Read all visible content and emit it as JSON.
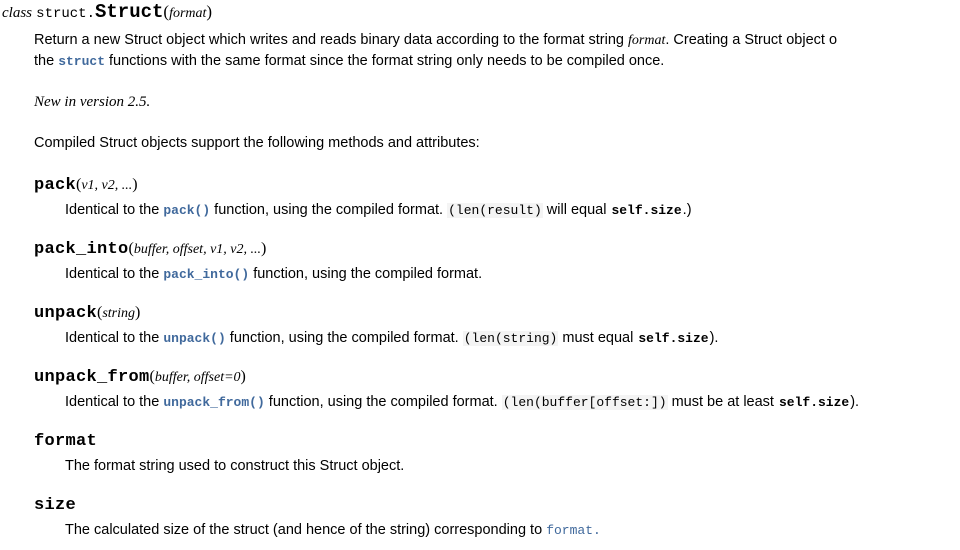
{
  "signature": {
    "keyword": "class",
    "module_prefix": "struct.",
    "name": "Struct",
    "open_paren": "(",
    "param": "format",
    "close_paren": ")"
  },
  "intro": {
    "seg1": "Return a new Struct object which writes and reads binary data according to the format string ",
    "param_em": "format",
    "seg2": ". Creating a Struct object o",
    "line2_seg1": "the ",
    "line2_code": "struct",
    "line2_seg2": " functions with the same format since the format string only needs to be compiled once."
  },
  "version_note": "New in version 2.5.",
  "compiled_note": "Compiled Struct objects support the following methods and attributes:",
  "methods": [
    {
      "name": "pack",
      "open_paren": "(",
      "params": "v1, v2, ...",
      "close_paren": ")",
      "desc_seg1": "Identical to the ",
      "desc_link": "pack()",
      "desc_seg2": " function, using the compiled format. ",
      "desc_code1": "(len(result)",
      "desc_seg3": " will equal ",
      "desc_code2": "self.size",
      "desc_seg4": ".)"
    },
    {
      "name": "pack_into",
      "open_paren": "(",
      "params": "buffer, offset, v1, v2, ...",
      "close_paren": ")",
      "desc_seg1": "Identical to the ",
      "desc_link": "pack_into()",
      "desc_seg2": " function, using the compiled format.",
      "desc_code1": "",
      "desc_seg3": "",
      "desc_code2": "",
      "desc_seg4": ""
    },
    {
      "name": "unpack",
      "open_paren": "(",
      "params": "string",
      "close_paren": ")",
      "desc_seg1": "Identical to the ",
      "desc_link": "unpack()",
      "desc_seg2": " function, using the compiled format. ",
      "desc_code1": "(len(string)",
      "desc_seg3": " must equal ",
      "desc_code2": "self.size",
      "desc_seg4": ")."
    },
    {
      "name": "unpack_from",
      "open_paren": "(",
      "params": "buffer, offset=0",
      "close_paren": ")",
      "desc_seg1": "Identical to the ",
      "desc_link": "unpack_from()",
      "desc_seg2": " function, using the compiled format. ",
      "desc_code1": "(len(buffer[offset:])",
      "desc_seg3": " must be at least ",
      "desc_code2": "self.size",
      "desc_seg4": ")."
    }
  ],
  "attributes": [
    {
      "name": "format",
      "desc_seg1": "The format string used to construct this Struct object.",
      "desc_link": "",
      "desc_seg2": ""
    },
    {
      "name": "size",
      "desc_seg1": "The calculated size of the struct (and hence of the string) corresponding to ",
      "desc_link": "format.",
      "desc_seg2": ""
    }
  ],
  "colors": {
    "link": "#40699c",
    "text": "#000000",
    "background": "#ffffff",
    "code_background": "#f4f4f4"
  }
}
